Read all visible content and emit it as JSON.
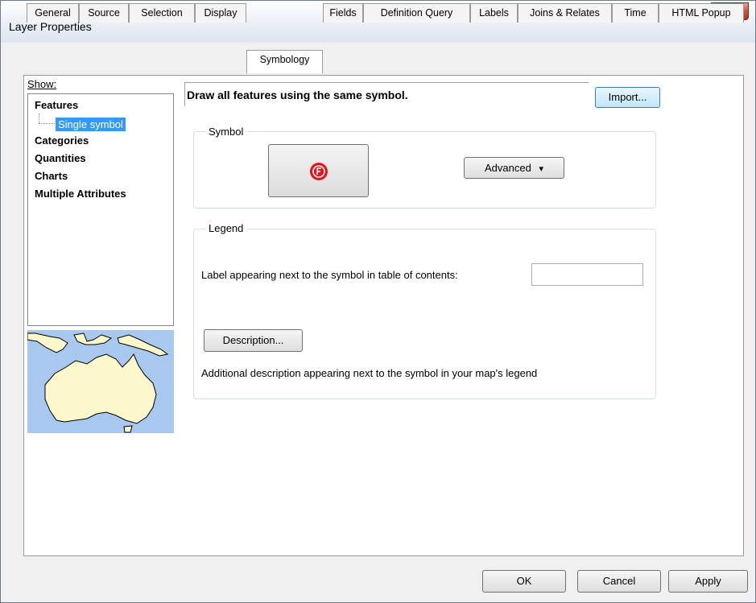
{
  "window": {
    "title": "Layer Properties",
    "close_label": "X"
  },
  "tabs": [
    {
      "label": "General"
    },
    {
      "label": "Source"
    },
    {
      "label": "Selection"
    },
    {
      "label": "Display"
    },
    {
      "label": "Symbology",
      "active": true
    },
    {
      "label": "Fields"
    },
    {
      "label": "Definition Query"
    },
    {
      "label": "Labels"
    },
    {
      "label": "Joins & Relates"
    },
    {
      "label": "Time"
    },
    {
      "label": "HTML Popup"
    }
  ],
  "show_panel": {
    "label": "Show:",
    "items": [
      {
        "label": "Features"
      },
      {
        "label": "Single symbol",
        "selected": true
      },
      {
        "label": "Categories"
      },
      {
        "label": "Quantities"
      },
      {
        "label": "Charts"
      },
      {
        "label": "Multiple Attributes"
      }
    ],
    "preview_icon": "australia-map-thumbnail"
  },
  "symbology": {
    "heading": "Draw all features using the same symbol.",
    "import_label": "Import...",
    "symbol_group": {
      "title": "Symbol",
      "symbol_icon": "fire-station-symbol-icon",
      "symbol_color": "#e8141b",
      "advanced_label": "Advanced",
      "advanced_arrow": "▾"
    },
    "legend_group": {
      "title": "Legend",
      "label_prompt": "Label appearing next to the symbol in table of contents:",
      "label_value": "",
      "description_button": "Description...",
      "description_text": "Additional description appearing next to the symbol in your map's legend"
    }
  },
  "footer": {
    "ok": "OK",
    "cancel": "Cancel",
    "apply": "Apply"
  },
  "colors": {
    "selection": "#3399ff",
    "close_button": "#c74b33",
    "map_water": "#a8c8f0",
    "map_land": "#fcf8cc"
  }
}
